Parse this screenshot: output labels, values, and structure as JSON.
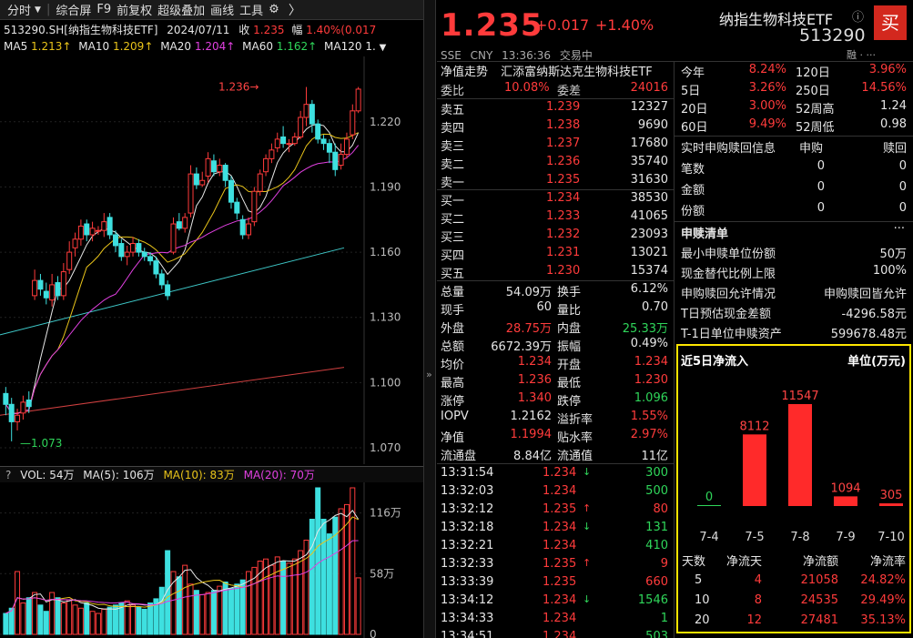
{
  "toolbar": {
    "tab": "分时",
    "items": [
      "综合屏",
      "F9",
      "前复权",
      "超级叠加",
      "画线",
      "工具"
    ]
  },
  "title": {
    "code_name": "513290.SH[纳指生物科技ETF]",
    "date": "2024/07/11",
    "close_label": "收",
    "close": "1.235",
    "amp_label": "幅",
    "amp": "1.40%(0.017"
  },
  "ma": {
    "ma5_label": "MA5",
    "ma5": "1.213",
    "ma10_label": "MA10",
    "ma10": "1.209",
    "ma20_label": "MA20",
    "ma20": "1.204",
    "ma60_label": "MA60",
    "ma60": "1.162",
    "ma120_label": "MA120",
    "ma120": "1."
  },
  "kchart": {
    "yticks": [
      "1.220",
      "1.190",
      "1.160",
      "1.130",
      "1.100",
      "1.070"
    ],
    "high_label": "1.236",
    "low_label": "1.073"
  },
  "vol": {
    "q": "?",
    "text_vol": "VOL: 54万",
    "text_ma5": "MA(5): 106万",
    "text_ma10": "MA(10): 83万",
    "text_ma20": "MA(20): 70万",
    "yticks": [
      "116万",
      "58万",
      "0"
    ]
  },
  "quote": {
    "price": "1.235",
    "change": "+0.017",
    "pct": "+1.40%",
    "name": "纳指生物科技ETF",
    "code": "513290",
    "buy": "买",
    "market": "SSE",
    "currency": "CNY",
    "time": "13:36:36",
    "status": "交易中",
    "icons": "融 · ···"
  },
  "nav": {
    "label": "净值走势",
    "fund": "汇添富纳斯达克生物科技ETF"
  },
  "weibi": {
    "l1": "委比",
    "v1": "10.08%",
    "l2": "委差",
    "v2": "24016"
  },
  "asks": [
    {
      "l": "卖五",
      "p": "1.239",
      "v": "12327"
    },
    {
      "l": "卖四",
      "p": "1.238",
      "v": "9690"
    },
    {
      "l": "卖三",
      "p": "1.237",
      "v": "17680"
    },
    {
      "l": "卖二",
      "p": "1.236",
      "v": "35740"
    },
    {
      "l": "卖一",
      "p": "1.235",
      "v": "31630"
    }
  ],
  "bids": [
    {
      "l": "买一",
      "p": "1.234",
      "v": "38530"
    },
    {
      "l": "买二",
      "p": "1.233",
      "v": "41065"
    },
    {
      "l": "买三",
      "p": "1.232",
      "v": "23093"
    },
    {
      "l": "买四",
      "p": "1.231",
      "v": "13021"
    },
    {
      "l": "买五",
      "p": "1.230",
      "v": "15374"
    }
  ],
  "stats": [
    {
      "l1": "总量",
      "v1": "54.09万",
      "c1": "white",
      "l2": "换手",
      "v2": "6.12%",
      "c2": "white"
    },
    {
      "l1": "现手",
      "v1": "60",
      "c1": "white",
      "l2": "量比",
      "v2": "0.70",
      "c2": "white"
    },
    {
      "l1": "外盘",
      "v1": "28.75万",
      "c1": "red",
      "l2": "内盘",
      "v2": "25.33万",
      "c2": "green"
    },
    {
      "l1": "总额",
      "v1": "6672.39万",
      "c1": "white",
      "l2": "振幅",
      "v2": "0.49%",
      "c2": "white"
    },
    {
      "l1": "均价",
      "v1": "1.234",
      "c1": "red",
      "l2": "开盘",
      "v2": "1.234",
      "c2": "red"
    },
    {
      "l1": "最高",
      "v1": "1.236",
      "c1": "red",
      "l2": "最低",
      "v2": "1.230",
      "c2": "red"
    },
    {
      "l1": "涨停",
      "v1": "1.340",
      "c1": "red",
      "l2": "跌停",
      "v2": "1.096",
      "c2": "green"
    },
    {
      "l1": "IOPV",
      "v1": "1.2162",
      "c1": "white",
      "l2": "溢折率",
      "v2": "1.55%",
      "c2": "red"
    },
    {
      "l1": "净值",
      "v1": "1.1994",
      "c1": "red",
      "l2": "贴水率",
      "v2": "2.97%",
      "c2": "red"
    },
    {
      "l1": "流通盘",
      "v1": "8.84亿",
      "c1": "white",
      "l2": "流通值",
      "v2": "11亿",
      "c2": "white"
    }
  ],
  "ticks": [
    {
      "t": "13:31:54",
      "p": "1.234",
      "a": "↓",
      "ac": "green",
      "v": "300",
      "vc": "green"
    },
    {
      "t": "13:32:03",
      "p": "1.234",
      "a": "",
      "ac": "green",
      "v": "500",
      "vc": "green"
    },
    {
      "t": "13:32:12",
      "p": "1.235",
      "a": "↑",
      "ac": "red",
      "v": "80",
      "vc": "red"
    },
    {
      "t": "13:32:18",
      "p": "1.234",
      "a": "↓",
      "ac": "green",
      "v": "131",
      "vc": "green"
    },
    {
      "t": "13:32:21",
      "p": "1.234",
      "a": "",
      "ac": "green",
      "v": "410",
      "vc": "green"
    },
    {
      "t": "13:32:33",
      "p": "1.235",
      "a": "↑",
      "ac": "red",
      "v": "9",
      "vc": "red"
    },
    {
      "t": "13:33:39",
      "p": "1.235",
      "a": "",
      "ac": "red",
      "v": "660",
      "vc": "red"
    },
    {
      "t": "13:34:12",
      "p": "1.234",
      "a": "↓",
      "ac": "green",
      "v": "1546",
      "vc": "green"
    },
    {
      "t": "13:34:33",
      "p": "1.234",
      "a": "",
      "ac": "green",
      "v": "1",
      "vc": "green"
    },
    {
      "t": "13:34:51",
      "p": "1.234",
      "a": "",
      "ac": "green",
      "v": "503",
      "vc": "green"
    }
  ],
  "perf": [
    {
      "l1": "今年",
      "v1": "8.24%",
      "c1": "red",
      "l2": "120日",
      "v2": "3.96%",
      "c2": "red"
    },
    {
      "l1": "5日",
      "v1": "3.26%",
      "c1": "red",
      "l2": "250日",
      "v2": "14.56%",
      "c2": "red"
    },
    {
      "l1": "20日",
      "v1": "3.00%",
      "c1": "red",
      "l2": "52周高",
      "v2": "1.24",
      "c2": "white"
    },
    {
      "l1": "60日",
      "v1": "9.49%",
      "c1": "red",
      "l2": "52周低",
      "v2": "0.98",
      "c2": "white"
    }
  ],
  "redeem": {
    "h1": "实时申购赎回信息",
    "h2": "申购",
    "h3": "赎回",
    "rows": [
      {
        "l": "笔数",
        "a": "0",
        "b": "0"
      },
      {
        "l": "金额",
        "a": "0",
        "b": "0"
      },
      {
        "l": "份额",
        "a": "0",
        "b": "0"
      }
    ]
  },
  "list": {
    "title": "申赎清单",
    "more": "···",
    "rows": [
      {
        "l": "最小申赎单位份额",
        "v": "50万"
      },
      {
        "l": "现金替代比例上限",
        "v": "100%"
      },
      {
        "l": "申购赎回允许情况",
        "v": "申购赎回皆允许"
      },
      {
        "l": "T日预估现金差额",
        "v": "-4296.58元"
      },
      {
        "l": "T-1日单位申赎资产",
        "v": "599678.48元"
      }
    ]
  },
  "inflow": {
    "title": "近5日净流入",
    "unit": "单位(万元)",
    "headers": [
      "天数",
      "净流天",
      "净流额",
      "净流率"
    ],
    "rows": [
      {
        "d": "5",
        "n": "4",
        "amt": "21058",
        "r": "24.82%"
      },
      {
        "d": "10",
        "n": "8",
        "amt": "24535",
        "r": "29.49%"
      },
      {
        "d": "20",
        "n": "12",
        "amt": "27481",
        "r": "35.13%"
      }
    ]
  },
  "chart_data": [
    {
      "type": "bar",
      "title": "近5日净流入",
      "ylabel": "单位(万元)",
      "categories": [
        "7-4",
        "7-5",
        "7-8",
        "7-9",
        "7-10"
      ],
      "values": [
        0,
        8112,
        11547,
        1094,
        305
      ]
    },
    {
      "type": "candlestick",
      "yticks": [
        1.22,
        1.19,
        1.16,
        1.13,
        1.1,
        1.07
      ],
      "ylim": [
        1.065,
        1.24
      ],
      "candles": [
        [
          1.095,
          1.09,
          1.098,
          1.085
        ],
        [
          1.09,
          1.082,
          1.093,
          1.073
        ],
        [
          1.082,
          1.085,
          1.088,
          1.078
        ],
        [
          1.086,
          1.091,
          1.094,
          1.083
        ],
        [
          1.092,
          1.089,
          1.096,
          1.086
        ],
        [
          1.14,
          1.147,
          1.152,
          1.138
        ],
        [
          1.147,
          1.143,
          1.15,
          1.14
        ],
        [
          1.142,
          1.139,
          1.146,
          1.136
        ],
        [
          1.138,
          1.145,
          1.15,
          1.135
        ],
        [
          1.146,
          1.14,
          1.149,
          1.138
        ],
        [
          1.14,
          1.151,
          1.155,
          1.138
        ],
        [
          1.152,
          1.16,
          1.165,
          1.15
        ],
        [
          1.162,
          1.166,
          1.169,
          1.158
        ],
        [
          1.166,
          1.172,
          1.175,
          1.163
        ],
        [
          1.173,
          1.168,
          1.175,
          1.165
        ],
        [
          1.168,
          1.171,
          1.174,
          1.165
        ],
        [
          1.17,
          1.17,
          1.172,
          1.168
        ],
        [
          1.17,
          1.174,
          1.178,
          1.167
        ],
        [
          1.176,
          1.168,
          1.178,
          1.166
        ],
        [
          1.168,
          1.163,
          1.17,
          1.16
        ],
        [
          1.164,
          1.158,
          1.166,
          1.156
        ],
        [
          1.158,
          1.16,
          1.163,
          1.154
        ],
        [
          1.16,
          1.164,
          1.167,
          1.158
        ],
        [
          1.164,
          1.16,
          1.166,
          1.158
        ],
        [
          1.16,
          1.158,
          1.162,
          1.156
        ],
        [
          1.158,
          1.156,
          1.16,
          1.154
        ],
        [
          1.156,
          1.15,
          1.158,
          1.148
        ],
        [
          1.15,
          1.145,
          1.152,
          1.143
        ],
        [
          1.145,
          1.14,
          1.147,
          1.138
        ],
        [
          1.16,
          1.173,
          1.176,
          1.159
        ],
        [
          1.174,
          1.171,
          1.178,
          1.17
        ],
        [
          1.171,
          1.176,
          1.178,
          1.169
        ],
        [
          1.178,
          1.196,
          1.2,
          1.176
        ],
        [
          1.196,
          1.191,
          1.199,
          1.189
        ],
        [
          1.191,
          1.193,
          1.197,
          1.19
        ],
        [
          1.195,
          1.203,
          1.206,
          1.192
        ],
        [
          1.202,
          1.197,
          1.205,
          1.195
        ],
        [
          1.197,
          1.2,
          1.203,
          1.195
        ],
        [
          1.2,
          1.193,
          1.201,
          1.19
        ],
        [
          1.193,
          1.183,
          1.195,
          1.18
        ],
        [
          1.183,
          1.178,
          1.185,
          1.175
        ],
        [
          1.175,
          1.168,
          1.177,
          1.166
        ],
        [
          1.168,
          1.173,
          1.176,
          1.166
        ],
        [
          1.174,
          1.188,
          1.19,
          1.172
        ],
        [
          1.188,
          1.196,
          1.198,
          1.186
        ],
        [
          1.197,
          1.203,
          1.205,
          1.195
        ],
        [
          1.203,
          1.207,
          1.21,
          1.201
        ],
        [
          1.208,
          1.212,
          1.215,
          1.206
        ],
        [
          1.213,
          1.21,
          1.218,
          1.208
        ],
        [
          1.21,
          1.21,
          1.212,
          1.206
        ],
        [
          1.21,
          1.213,
          1.215,
          1.209
        ],
        [
          1.213,
          1.222,
          1.225,
          1.212
        ],
        [
          1.222,
          1.228,
          1.236,
          1.218
        ],
        [
          1.228,
          1.219,
          1.23,
          1.215
        ],
        [
          1.219,
          1.212,
          1.221,
          1.21
        ],
        [
          1.212,
          1.21,
          1.214,
          1.207
        ],
        [
          1.21,
          1.206,
          1.212,
          1.201
        ],
        [
          1.206,
          1.198,
          1.21,
          1.195
        ],
        [
          1.2,
          1.205,
          1.21,
          1.198
        ],
        [
          1.205,
          1.212,
          1.215,
          1.203
        ],
        [
          1.214,
          1.225,
          1.228,
          1.212
        ],
        [
          1.225,
          1.235,
          1.236,
          1.224
        ]
      ]
    },
    {
      "type": "bar",
      "title": "VOL",
      "ylim": [
        0,
        140
      ],
      "values": [
        20,
        25,
        60,
        30,
        35,
        40,
        28,
        22,
        40,
        35,
        30,
        33,
        28,
        25,
        30,
        22,
        20,
        24,
        26,
        28,
        30,
        32,
        28,
        26,
        24,
        30,
        34,
        45,
        80,
        60,
        55,
        66,
        48,
        42,
        38,
        40,
        42,
        46,
        50,
        44,
        48,
        52,
        60,
        64,
        70,
        72,
        66,
        74,
        70,
        68,
        72,
        80,
        90,
        110,
        140,
        110,
        96,
        112,
        120,
        124,
        140,
        54
      ]
    }
  ]
}
